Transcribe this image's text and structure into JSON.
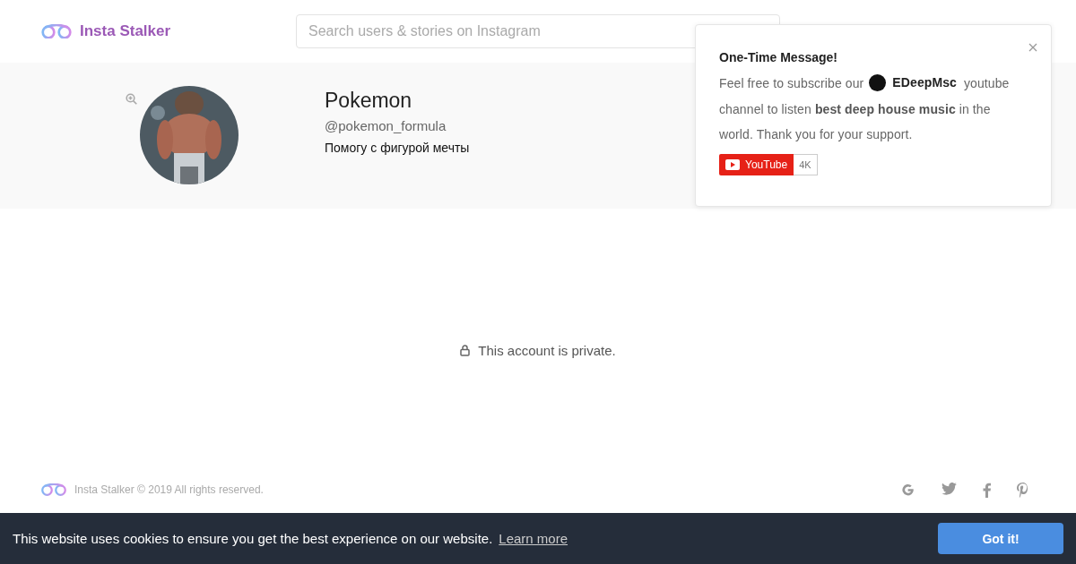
{
  "header": {
    "logo_text": "Insta Stalker",
    "search": {
      "placeholder": "Search users & stories on Instagram"
    }
  },
  "profile": {
    "name": "Pokemon",
    "username": "@pokemon_formula",
    "bio": "Помогу с фигурой мечты"
  },
  "private_message": "This account is private.",
  "popup": {
    "title": "One-Time Message!",
    "text_before": "Feel free to subscribe our",
    "channel_name": "EDeepMsc",
    "text_after": "youtube channel to listen **best deep house music** in the world. Thank you for your support.",
    "youtube_button": {
      "label": "YouTube",
      "count": "4K"
    }
  },
  "footer": {
    "copyright": "Insta Stalker © 2019 All rights reserved."
  },
  "cookie_bar": {
    "message": "This website uses cookies to ensure you get the best experience on our website.",
    "link": "Learn more",
    "button": "Got it!"
  }
}
